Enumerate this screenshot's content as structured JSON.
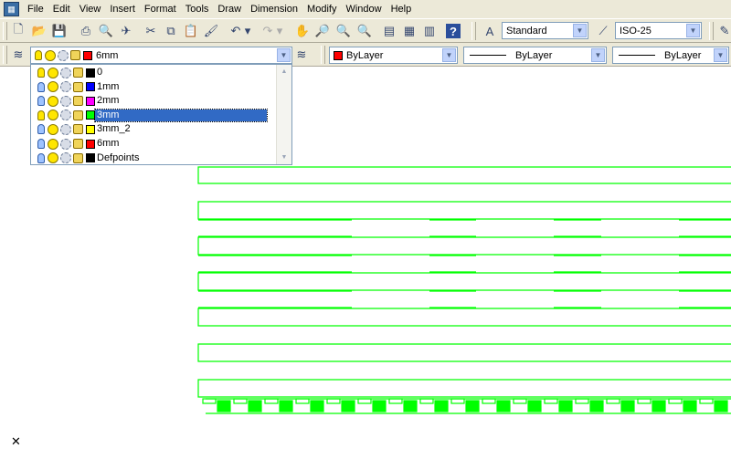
{
  "menu": [
    "File",
    "Edit",
    "View",
    "Insert",
    "Format",
    "Tools",
    "Draw",
    "Dimension",
    "Modify",
    "Window",
    "Help"
  ],
  "app_icon": "autocad-icon",
  "toolbar": {
    "text_style": "Standard",
    "dim_style": "ISO-25"
  },
  "properties": {
    "current_layer": "6mm",
    "color": "ByLayer",
    "color_hex": "#ff0000",
    "linetype": "ByLayer",
    "lineweight": "ByLayer"
  },
  "layers": [
    {
      "name": "0",
      "color": "#000000",
      "light": "on"
    },
    {
      "name": "1mm",
      "color": "#0000ff",
      "light": "off"
    },
    {
      "name": "2mm",
      "color": "#ff00ff",
      "light": "off"
    },
    {
      "name": "3mm",
      "color": "#00ff00",
      "light": "on",
      "selected": true
    },
    {
      "name": "3mm_2",
      "color": "#ffff00",
      "light": "off"
    },
    {
      "name": "6mm",
      "color": "#ff0000",
      "light": "off"
    },
    {
      "name": "Defpoints",
      "color": "#000000",
      "light": "off"
    }
  ],
  "drawing_color": "#00ff00"
}
